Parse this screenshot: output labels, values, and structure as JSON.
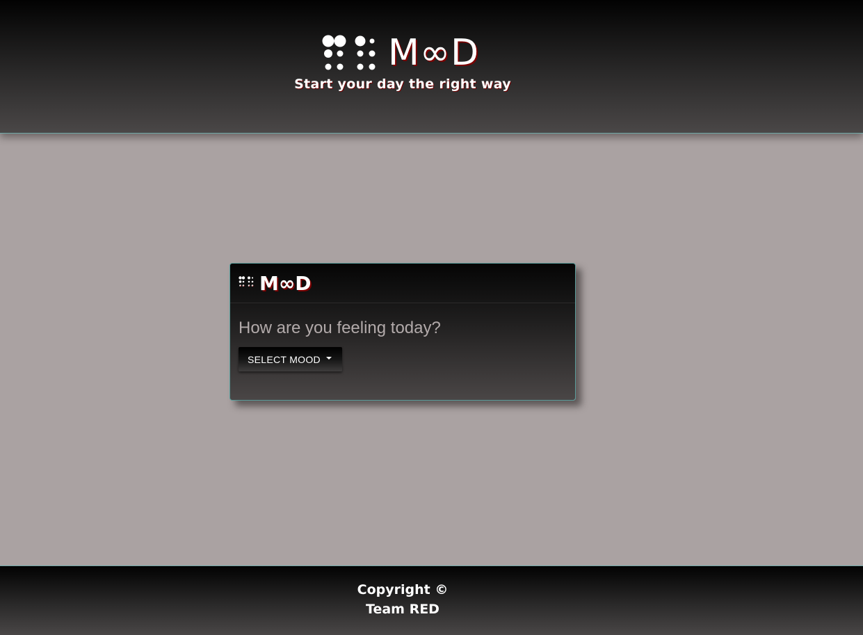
{
  "header": {
    "brand": "M∞D",
    "tagline": "Start your day the right way",
    "logo_icon": "braille-dots-icon"
  },
  "card": {
    "brand": "M∞D",
    "question": "How are you feeling today?",
    "dropdown_label": "SELECT MOOD",
    "logo_icon": "braille-dots-icon"
  },
  "footer": {
    "copyright_line": "Copyright ©",
    "team_line": "Team RED"
  },
  "colors": {
    "page_background": "#aaa2a2",
    "accent_border": "#6fa9a8",
    "text_shadow_red": "#7a0000",
    "header_dark": "#020202",
    "header_light": "#4a4747"
  }
}
